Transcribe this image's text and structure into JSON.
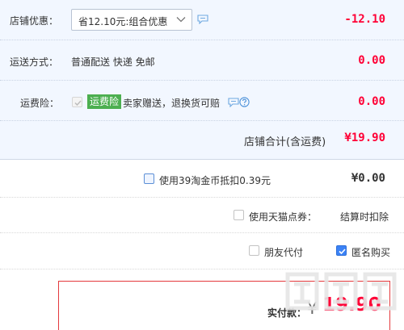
{
  "shop": {
    "discount": {
      "label": "店铺优惠：",
      "selected": "省12.10元:组合优惠",
      "amount": "-12.10"
    },
    "shipping": {
      "label": "运送方式：",
      "method": "普通配送 快递 免邮",
      "amount": "0.00"
    },
    "insurance": {
      "label": "运费险：",
      "badge": "运费险",
      "desc": "卖家赠送，退换货可赔",
      "amount": "0.00"
    },
    "total": {
      "label": "店铺合计(含运费)",
      "amount": "¥19.90"
    }
  },
  "taobao_coins": {
    "label": "使用39淘金币抵扣0.39元",
    "amount": "¥0.00"
  },
  "tmall_points": {
    "label": "使用天猫点券：",
    "note": "结算时扣除"
  },
  "options": {
    "friend_pay": "朋友代付",
    "anonymous": "匿名购买"
  },
  "payment": {
    "label": "实付款：",
    "currency": "¥",
    "amount": "19.90"
  },
  "colors": {
    "price_red": "#ff0036",
    "badge_green": "#4caf50",
    "panel_bg": "#f2f7ff",
    "checkbox_blue": "#3b82f6"
  }
}
